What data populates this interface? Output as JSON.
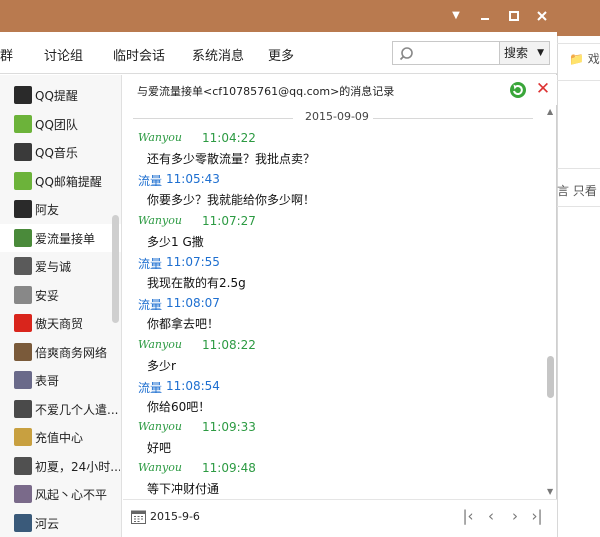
{
  "toolbar": {
    "partial_item": "群",
    "items": [
      "讨论组",
      "临时会话",
      "系统消息",
      "更多"
    ],
    "search_placeholder": "",
    "search_button": "搜索"
  },
  "sidebar": {
    "items": [
      {
        "label": "QQ提醒",
        "icon": "penguin-icon",
        "color": "#2a2a2a"
      },
      {
        "label": "QQ团队",
        "icon": "grass-icon",
        "color": "#6cb33a"
      },
      {
        "label": "QQ音乐",
        "icon": "music-icon",
        "color": "#3a3a3a"
      },
      {
        "label": "QQ邮箱提醒",
        "icon": "grass-icon",
        "color": "#6cb33a"
      },
      {
        "label": "阿友",
        "icon": "penguin-icon",
        "color": "#2a2a2a"
      },
      {
        "label": "爱流量接单",
        "icon": "avatar-icon",
        "color": "#4a8a3a"
      },
      {
        "label": "爱与诚",
        "icon": "avatar-icon",
        "color": "#5a5a5a"
      },
      {
        "label": "安妥",
        "icon": "avatar-icon",
        "color": "#888888"
      },
      {
        "label": "傲天商贸",
        "icon": "flag-icon",
        "color": "#d9251c"
      },
      {
        "label": "倍爽商务网络",
        "icon": "avatar-icon",
        "color": "#7a5a3a"
      },
      {
        "label": "表哥",
        "icon": "avatar-icon",
        "color": "#6a6a8a"
      },
      {
        "label": "不爱几个人遣...",
        "icon": "avatar-icon",
        "color": "#4a4a4a"
      },
      {
        "label": "充值中心",
        "icon": "avatar-icon",
        "color": "#c8a040"
      },
      {
        "label": "初夏，24小时...",
        "icon": "avatar-icon",
        "color": "#505050"
      },
      {
        "label": "风起丶心不平",
        "icon": "avatar-icon",
        "color": "#7a6a8a"
      },
      {
        "label": "河云",
        "icon": "avatar-icon",
        "color": "#3a5a7a"
      }
    ],
    "selected_index": 5
  },
  "chat": {
    "header_title": "与爱流量接单<cf10785761@qq.com>的消息记录",
    "date_separator": "2015-09-09",
    "self_name": "Wanyou",
    "messages": [
      {
        "sender": "Wanyou",
        "self": true,
        "time": "11:04:22",
        "text": "还有多少零散流量？我批点卖？"
      },
      {
        "sender": "流量",
        "self": false,
        "time": "11:05:43",
        "text": "你要多少？我就能给你多少啊！"
      },
      {
        "sender": "Wanyou",
        "self": true,
        "time": "11:07:27",
        "text": "多少1 G撒"
      },
      {
        "sender": "流量",
        "self": false,
        "time": "11:07:55",
        "text": "我现在散的有2.5g"
      },
      {
        "sender": "流量",
        "self": false,
        "time": "11:08:07",
        "text": "你都拿去吧！"
      },
      {
        "sender": "Wanyou",
        "self": true,
        "time": "11:08:22",
        "text": "多少r"
      },
      {
        "sender": "流量",
        "self": false,
        "time": "11:08:54",
        "text": "你给60吧！"
      },
      {
        "sender": "Wanyou",
        "self": true,
        "time": "11:09:33",
        "text": "好吧"
      },
      {
        "sender": "Wanyou",
        "self": true,
        "time": "11:09:48",
        "text": "等下冲财付通"
      }
    ],
    "footer_date": "2015-9-6"
  },
  "background": {
    "partial_tab": "📁 戏",
    "partial_hint": "言  只看"
  },
  "colors": {
    "titlebar": "#b97a4f",
    "self_name": "#2c9a42",
    "other_name": "#1e6fd0",
    "delete_icon": "#dd3333"
  }
}
